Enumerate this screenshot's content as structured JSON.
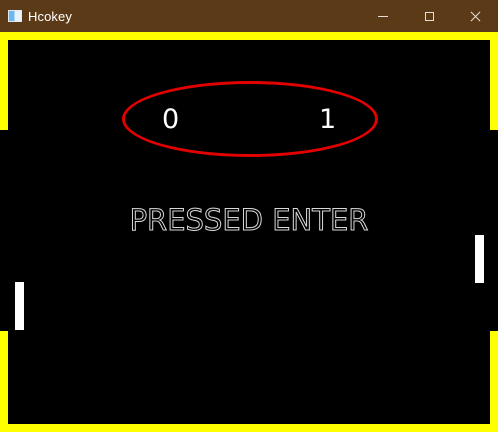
{
  "window": {
    "title": "Hcokey"
  },
  "titlebar_buttons": {
    "minimize_icon": "minimize-icon",
    "maximize_icon": "maximize-icon",
    "close_icon": "close-icon"
  },
  "game": {
    "score_left": "0",
    "score_right": "1",
    "message": "PRESSED ENTER"
  },
  "colors": {
    "titlebar": "#5b3a18",
    "wall": "#ffff00",
    "paddle": "#ffffff",
    "highlight_ellipse": "#e30000",
    "background": "#000000"
  }
}
